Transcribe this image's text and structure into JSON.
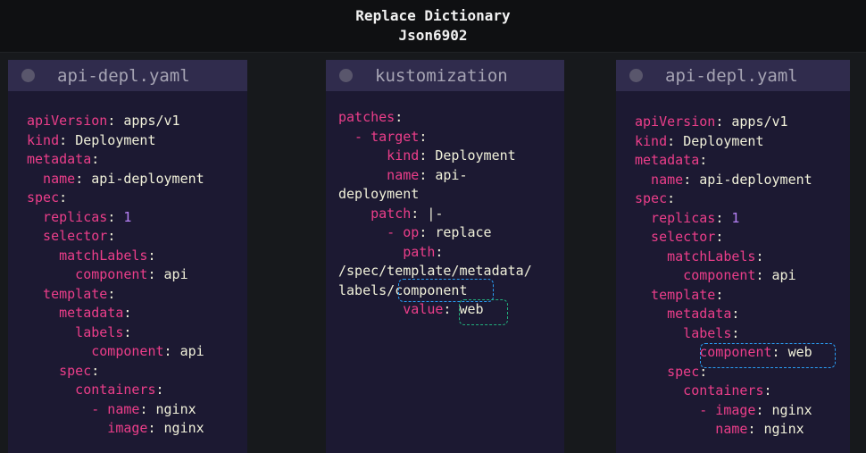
{
  "header": {
    "title_line1": "Replace Dictionary",
    "title_line2": "Json6902"
  },
  "panels": [
    {
      "title": "api-depl.yaml",
      "lines": [
        [
          "apiVersion",
          ": ",
          "apps/v1"
        ],
        [
          "kind",
          ": ",
          "Deployment"
        ],
        [
          "metadata",
          ":",
          ""
        ],
        [
          "  name",
          ": ",
          "api-deployment"
        ],
        [
          "spec",
          ":",
          ""
        ],
        [
          "  replicas",
          ": ",
          "1"
        ],
        [
          "  selector",
          ":",
          ""
        ],
        [
          "    matchLabels",
          ":",
          ""
        ],
        [
          "      component",
          ": ",
          "api"
        ],
        [
          "  template",
          ":",
          ""
        ],
        [
          "    metadata",
          ":",
          ""
        ],
        [
          "      labels",
          ":",
          ""
        ],
        [
          "        component",
          ": ",
          "api"
        ],
        [
          "    spec",
          ":",
          ""
        ],
        [
          "      containers",
          ":",
          ""
        ],
        [
          "        - name",
          ": ",
          "nginx"
        ],
        [
          "          image",
          ": ",
          "nginx"
        ]
      ]
    },
    {
      "title": "kustomization",
      "lines": [
        [
          "patches",
          ":",
          ""
        ],
        [
          "  - target",
          ":",
          ""
        ],
        [
          "      kind",
          ": ",
          "Deployment"
        ],
        [
          "      name",
          ": ",
          "api-"
        ],
        [
          "",
          "",
          "deployment"
        ],
        [
          "    patch",
          ": ",
          "|-"
        ],
        [
          "      - op",
          ": ",
          "replace"
        ],
        [
          "        path",
          ":",
          ""
        ],
        [
          "",
          "",
          "/spec/template/metadata/"
        ],
        [
          "",
          "",
          "labels/component"
        ],
        [
          "        value",
          ": ",
          "web"
        ]
      ]
    },
    {
      "title": "api-depl.yaml",
      "lines": [
        [
          "apiVersion",
          ": ",
          "apps/v1"
        ],
        [
          "kind",
          ": ",
          "Deployment"
        ],
        [
          "metadata",
          ":",
          ""
        ],
        [
          "  name",
          ": ",
          "api-deployment"
        ],
        [
          "spec",
          ":",
          ""
        ],
        [
          "  replicas",
          ": ",
          "1"
        ],
        [
          "  selector",
          ":",
          ""
        ],
        [
          "    matchLabels",
          ":",
          ""
        ],
        [
          "      component",
          ": ",
          "api"
        ],
        [
          "  template",
          ":",
          ""
        ],
        [
          "    metadata",
          ":",
          ""
        ],
        [
          "      labels",
          ":",
          ""
        ],
        [
          "        component",
          ": ",
          "web"
        ],
        [
          "    spec",
          ":",
          ""
        ],
        [
          "      containers",
          ":",
          ""
        ],
        [
          "        - image",
          ": ",
          "nginx"
        ],
        [
          "          name",
          ": ",
          "nginx"
        ]
      ]
    }
  ],
  "colors": {
    "key": "#ec3e8a",
    "value": "#f1f1da",
    "number": "#b681f5",
    "highlight_blue": "#2a9df4",
    "highlight_green": "#22b07d"
  }
}
